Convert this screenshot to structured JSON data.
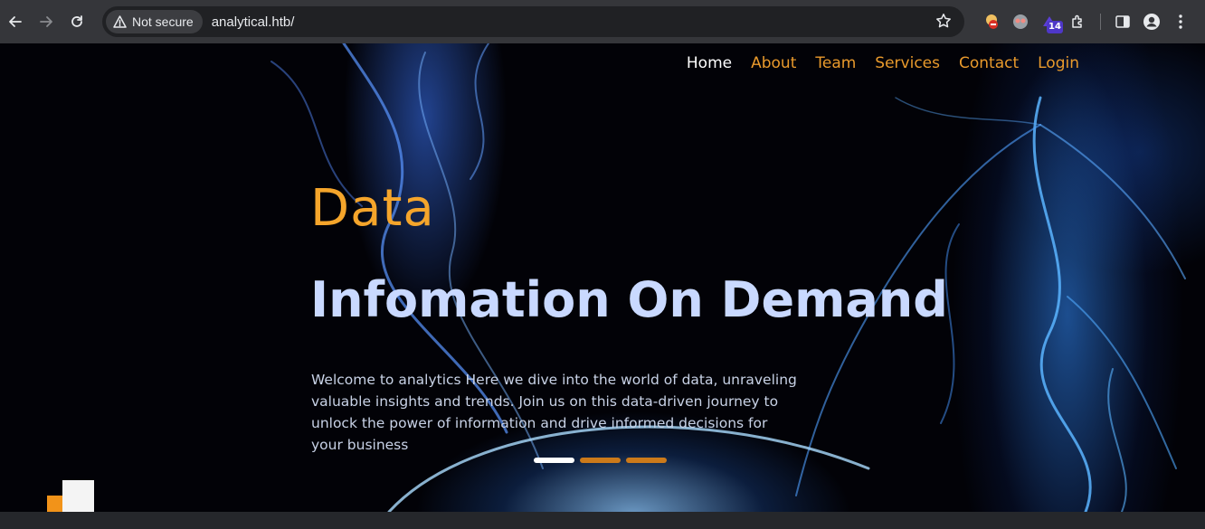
{
  "browser": {
    "security_label": "Not secure",
    "url": "analytical.htb/",
    "extension_badge": "14",
    "icons": [
      "back-icon",
      "forward-icon",
      "reload-icon",
      "warning-icon",
      "star-icon",
      "extension-icon",
      "side-panel-icon",
      "profile-icon",
      "menu-icon"
    ]
  },
  "site": {
    "nav": {
      "home": "Home",
      "about": "About",
      "team": "Team",
      "services": "Services",
      "contact": "Contact",
      "login": "Login"
    },
    "hero": {
      "kicker": "Data",
      "title": "Infomation On Demand",
      "body": "Welcome to analytics Here we dive into the world of data, unraveling valuable insights and trends. Join us on this data-driven journey to unlock the power of information and drive informed decisions for your business"
    },
    "carousel": {
      "slide_count": 3,
      "active_index": 0
    }
  },
  "colors": {
    "accent": "#e99a2c",
    "title": "#c9d9ff",
    "active_nav": "#ffffff"
  }
}
